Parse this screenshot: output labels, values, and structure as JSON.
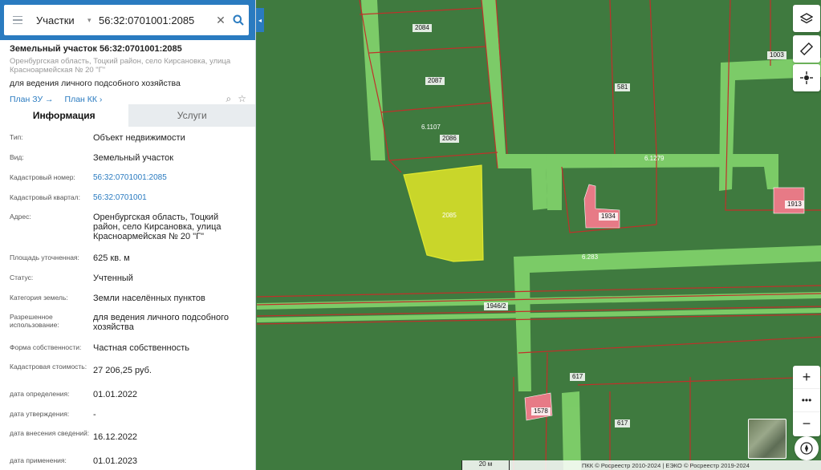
{
  "search": {
    "type_label": "Участки",
    "value": "56:32:0701001:2085"
  },
  "header": {
    "title": "Земельный участок 56:32:0701001:2085",
    "address": "Оренбургская область, Тоцкий район, село Кирсановка, улица Красноармейская № 20 \"Г\"",
    "purpose": "для ведения личного подсобного хозяйства",
    "link_plan_zu": "План ЗУ",
    "link_plan_kk": "План КК"
  },
  "tabs": {
    "info": "Информация",
    "services": "Услуги"
  },
  "info_rows": [
    {
      "key": "Тип:",
      "value": "Объект недвижимости"
    },
    {
      "key": "Вид:",
      "value": "Земельный участок"
    },
    {
      "key": "Кадастровый номер:",
      "value": "56:32:0701001:2085"
    },
    {
      "key": "Кадастровый квартал:",
      "value": "56:32:0701001"
    },
    {
      "key": "Адрес:",
      "value": "Оренбургская область, Тоцкий район, село Кирсановка, улица Красноармейская № 20 \"Г\""
    },
    {
      "key": "Площадь уточненная:",
      "value": "625 кв. м"
    },
    {
      "key": "Статус:",
      "value": "Учтенный"
    },
    {
      "key": "Категория земель:",
      "value": "Земли населённых пунктов"
    },
    {
      "key": "Разрешенное использование:",
      "value": "для ведения личного подсобного хозяйства"
    },
    {
      "key": "Форма собственности:",
      "value": "Частная собственность"
    },
    {
      "key": "Кадастровая стоимость:",
      "value": "27 206,25 руб."
    },
    {
      "key": "дата определения:",
      "value": "01.01.2022"
    },
    {
      "key": "дата утверждения:",
      "value": "-"
    },
    {
      "key": "дата внесения сведений:",
      "value": "16.12.2022"
    },
    {
      "key": "дата применения:",
      "value": "01.01.2023"
    }
  ],
  "map": {
    "labels": {
      "p2084": "2084",
      "p2087": "2087",
      "p2086": "2086",
      "p2085": "2085",
      "p1003": "1003",
      "p581": "581",
      "p1934": "1934",
      "p1913": "1913",
      "p617a": "617",
      "p617b": "617",
      "p1578": "1578",
      "r61107": "6.1107",
      "r61279": "6.1279",
      "r6283": "6.283",
      "r19462": "1946/2"
    },
    "scale": "20 м",
    "copyright": "ПКК © Росреестр 2010-2024 | ЕЭКО © Росреестр 2019-2024"
  },
  "colors": {
    "brand": "#2a7bc0",
    "selected_plot": "#c9d62a",
    "boundary": "#c0302a",
    "zone": "#7fd06a",
    "building": "#e77a86"
  }
}
